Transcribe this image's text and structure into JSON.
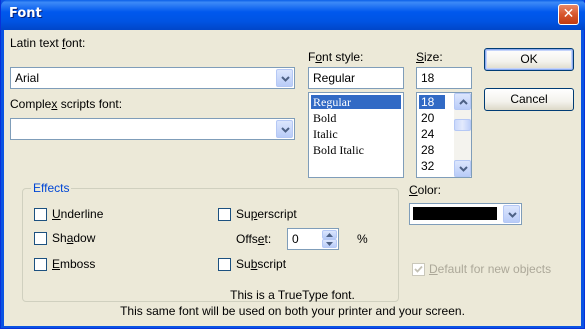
{
  "window": {
    "title": "Font",
    "close_glyph": "✕"
  },
  "latin_font": {
    "label_pre": "Latin text ",
    "label_key": "f",
    "label_post": "ont:",
    "value": "Arial"
  },
  "complex_font": {
    "label_pre": "Comple",
    "label_key": "x",
    "label_post": " scripts font:",
    "value": ""
  },
  "font_style": {
    "label_pre": "F",
    "label_key": "o",
    "label_post": "nt style:",
    "value": "Regular",
    "items": [
      "Regular",
      "Bold",
      "Italic",
      "Bold Italic"
    ],
    "selected": "Regular"
  },
  "size": {
    "label_pre": "",
    "label_key": "S",
    "label_post": "ize:",
    "value": "18",
    "items": [
      "18",
      "20",
      "24",
      "28",
      "32"
    ],
    "selected": "18"
  },
  "buttons": {
    "ok": "OK",
    "cancel": "Cancel"
  },
  "effects": {
    "title": "Effects",
    "underline": {
      "pre": "",
      "key": "U",
      "post": "nderline",
      "checked": false
    },
    "shadow": {
      "pre": "Sh",
      "key": "a",
      "post": "dow",
      "checked": false
    },
    "emboss": {
      "pre": "",
      "key": "E",
      "post": "mboss",
      "checked": false
    },
    "superscript": {
      "pre": "Su",
      "key": "p",
      "post": "erscript",
      "checked": false
    },
    "subscript": {
      "pre": "Su",
      "key": "b",
      "post": "script",
      "checked": false
    },
    "offset": {
      "pre": "Offs",
      "key": "e",
      "post": "t:",
      "value": "0",
      "unit": "%"
    }
  },
  "color": {
    "label_pre": "",
    "label_key": "C",
    "label_post": "olor:",
    "value_hex": "#000000"
  },
  "default_objects": {
    "pre": "",
    "key": "D",
    "post": "efault for new objects",
    "checked": true,
    "enabled": false
  },
  "info": {
    "line1": "This is a TrueType font.",
    "line2": "This same font will be used on both your printer and your screen."
  },
  "icons": {
    "close": "close-icon",
    "dropdown": "chevron-down-icon",
    "scroll_up": "chevron-up-icon",
    "scroll_down": "chevron-down-icon",
    "check": "checkmark-icon"
  },
  "colors": {
    "titlebar": "#0054e3",
    "dialog_bg": "#ece9d8",
    "selection": "#316ac5",
    "group_title": "#0046d5"
  }
}
